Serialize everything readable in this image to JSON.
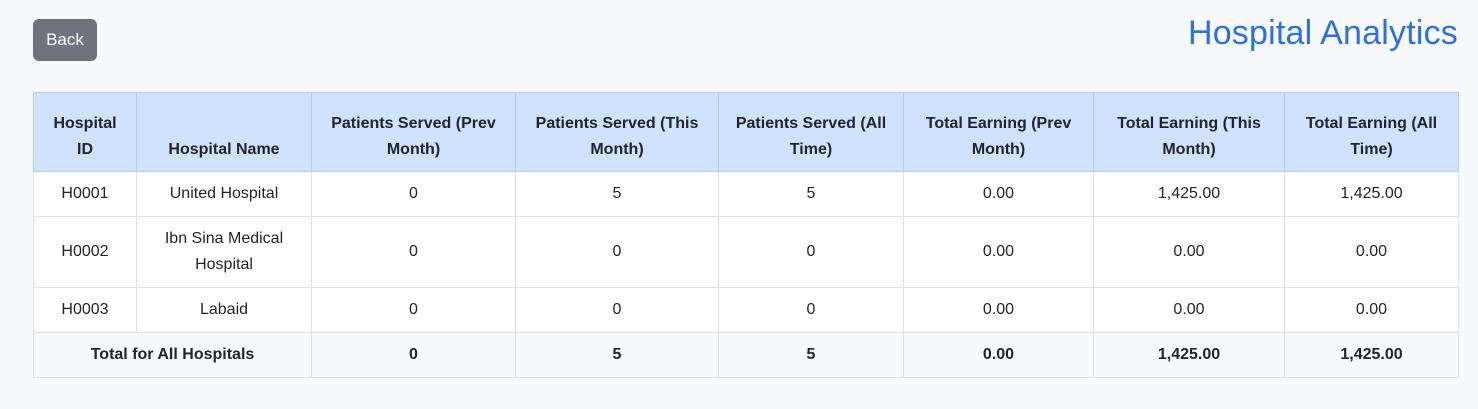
{
  "header": {
    "back_label": "Back",
    "title": "Hospital Analytics"
  },
  "table": {
    "columns": [
      "Hospital ID",
      "Hospital Name",
      "Patients Served (Prev Month)",
      "Patients Served (This Month)",
      "Patients Served (All Time)",
      "Total Earning (Prev Month)",
      "Total Earning (This Month)",
      "Total Earning (All Time)"
    ],
    "rows": [
      [
        "H0001",
        "United Hospital",
        "0",
        "5",
        "5",
        "0.00",
        "1,425.00",
        "1,425.00"
      ],
      [
        "H0002",
        "Ibn Sina Medical Hospital",
        "0",
        "0",
        "0",
        "0.00",
        "0.00",
        "0.00"
      ],
      [
        "H0003",
        "Labaid",
        "0",
        "0",
        "0",
        "0.00",
        "0.00",
        "0.00"
      ]
    ],
    "total": {
      "label": "Total for All Hospitals",
      "values": [
        "0",
        "5",
        "5",
        "0.00",
        "1,425.00",
        "1,425.00"
      ]
    }
  },
  "colors": {
    "title": "#2f6fe4",
    "back_button": "#6c757d",
    "header_row": "#cfe2ff",
    "page_background": "#f8f9fa"
  }
}
